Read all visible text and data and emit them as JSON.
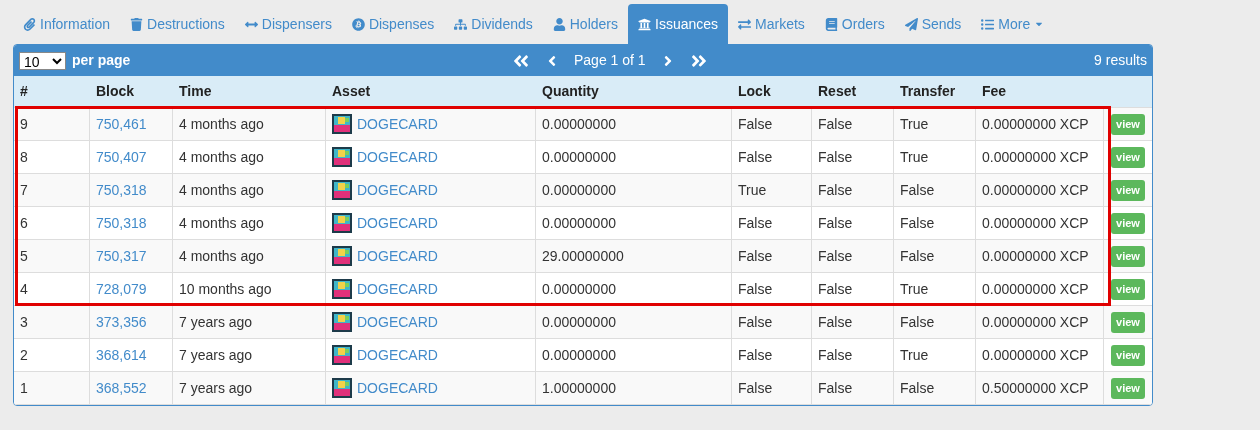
{
  "tabs": [
    {
      "label": "Information",
      "selected": false
    },
    {
      "label": "Destructions",
      "selected": false
    },
    {
      "label": "Dispensers",
      "selected": false
    },
    {
      "label": "Dispenses",
      "selected": false
    },
    {
      "label": "Dividends",
      "selected": false
    },
    {
      "label": "Holders",
      "selected": false
    },
    {
      "label": "Issuances",
      "selected": true
    },
    {
      "label": "Markets",
      "selected": false
    },
    {
      "label": "Orders",
      "selected": false
    },
    {
      "label": "Sends",
      "selected": false
    },
    {
      "label": "More",
      "selected": false,
      "kind": "dropdown"
    }
  ],
  "toolbar": {
    "per_page_value": "10",
    "per_page_label": "per page",
    "page": "Page 1 of 1",
    "results": "9 results"
  },
  "table": {
    "columns": [
      "#",
      "Block",
      "Time",
      "Asset",
      "Quantity",
      "Lock",
      "Reset",
      "Transfer",
      "Fee"
    ],
    "rows": [
      {
        "n": "9",
        "block": "750,461",
        "time": "4 months ago",
        "asset": "DOGECARD",
        "quantity": "0.00000000",
        "lock": "False",
        "reset": "False",
        "transfer": "True",
        "fee": "0.00000000 XCP",
        "action": "view",
        "highlighted": true
      },
      {
        "n": "8",
        "block": "750,407",
        "time": "4 months ago",
        "asset": "DOGECARD",
        "quantity": "0.00000000",
        "lock": "False",
        "reset": "False",
        "transfer": "True",
        "fee": "0.00000000 XCP",
        "action": "view",
        "highlighted": true
      },
      {
        "n": "7",
        "block": "750,318",
        "time": "4 months ago",
        "asset": "DOGECARD",
        "quantity": "0.00000000",
        "lock": "True",
        "reset": "False",
        "transfer": "False",
        "fee": "0.00000000 XCP",
        "action": "view",
        "highlighted": true
      },
      {
        "n": "6",
        "block": "750,318",
        "time": "4 months ago",
        "asset": "DOGECARD",
        "quantity": "0.00000000",
        "lock": "False",
        "reset": "False",
        "transfer": "False",
        "fee": "0.00000000 XCP",
        "action": "view",
        "highlighted": true
      },
      {
        "n": "5",
        "block": "750,317",
        "time": "4 months ago",
        "asset": "DOGECARD",
        "quantity": "29.00000000",
        "lock": "False",
        "reset": "False",
        "transfer": "False",
        "fee": "0.00000000 XCP",
        "action": "view",
        "highlighted": true
      },
      {
        "n": "4",
        "block": "728,079",
        "time": "10 months ago",
        "asset": "DOGECARD",
        "quantity": "0.00000000",
        "lock": "False",
        "reset": "False",
        "transfer": "True",
        "fee": "0.00000000 XCP",
        "action": "view",
        "highlighted": true
      },
      {
        "n": "3",
        "block": "373,356",
        "time": "7 years ago",
        "asset": "DOGECARD",
        "quantity": "0.00000000",
        "lock": "False",
        "reset": "False",
        "transfer": "False",
        "fee": "0.00000000 XCP",
        "action": "view",
        "highlighted": false
      },
      {
        "n": "2",
        "block": "368,614",
        "time": "7 years ago",
        "asset": "DOGECARD",
        "quantity": "0.00000000",
        "lock": "False",
        "reset": "False",
        "transfer": "True",
        "fee": "0.00000000 XCP",
        "action": "view",
        "highlighted": false
      },
      {
        "n": "1",
        "block": "368,552",
        "time": "7 years ago",
        "asset": "DOGECARD",
        "quantity": "1.00000000",
        "lock": "False",
        "reset": "False",
        "transfer": "False",
        "fee": "0.50000000 XCP",
        "action": "view",
        "highlighted": false
      }
    ]
  }
}
